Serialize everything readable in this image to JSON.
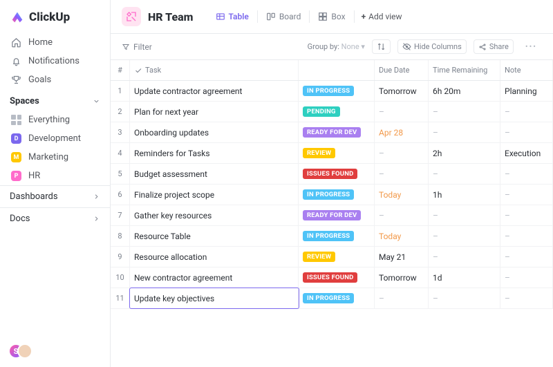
{
  "brand": "ClickUp",
  "nav": {
    "home": "Home",
    "notifications": "Notifications",
    "goals": "Goals"
  },
  "spaces": {
    "header": "Spaces",
    "everything": "Everything",
    "items": [
      {
        "label": "Development",
        "letter": "D",
        "color": "#7b68ee"
      },
      {
        "label": "Marketing",
        "letter": "M",
        "color": "#ffc800"
      },
      {
        "label": "HR",
        "letter": "P",
        "color": "#ff6bcb"
      }
    ]
  },
  "dashboards": "Dashboards",
  "docs": "Docs",
  "header": {
    "title": "HR Team",
    "tabs": {
      "table": "Table",
      "board": "Board",
      "box": "Box"
    },
    "add_view": "Add view"
  },
  "toolbar": {
    "filter": "Filter",
    "group_by": "Group by:",
    "group_by_val": "None",
    "hide_cols": "Hide Columns",
    "share": "Share"
  },
  "columns": {
    "num": "#",
    "task": "Task",
    "due": "Due Date",
    "remaining": "Time Remaining",
    "note": "Note"
  },
  "status_colors": {
    "IN PROGRESS": "#4fc3f7",
    "PENDING": "#2ecfc0",
    "READY FOR DEV": "#a97ff0",
    "REVIEW": "#ffc800",
    "ISSUES FOUND": "#e03e3e"
  },
  "rows": [
    {
      "n": "1",
      "name": "Update contractor agreement",
      "status": "IN PROGRESS",
      "due": "Tomorrow",
      "due_cls": "",
      "rem": "6h 20m",
      "note": "Planning"
    },
    {
      "n": "2",
      "name": "Plan for next year",
      "status": "PENDING",
      "due": "–",
      "due_cls": "dash-txt",
      "rem": "–",
      "note": "–"
    },
    {
      "n": "3",
      "name": "Onboarding updates",
      "status": "READY FOR DEV",
      "due": "Apr 28",
      "due_cls": "due-soon",
      "rem": "–",
      "note": "–"
    },
    {
      "n": "4",
      "name": "Reminders for Tasks",
      "status": "REVIEW",
      "due": "–",
      "due_cls": "dash-txt",
      "rem": "2h",
      "note": "Execution"
    },
    {
      "n": "5",
      "name": "Budget assessment",
      "status": "ISSUES FOUND",
      "due": "–",
      "due_cls": "dash-txt",
      "rem": "–",
      "note": "–"
    },
    {
      "n": "6",
      "name": "Finalize project scope",
      "status": "IN PROGRESS",
      "due": "Today",
      "due_cls": "due-today",
      "rem": "1h",
      "note": "–"
    },
    {
      "n": "7",
      "name": "Gather key resources",
      "status": "READY FOR DEV",
      "due": "–",
      "due_cls": "dash-txt",
      "rem": "–",
      "note": "–"
    },
    {
      "n": "8",
      "name": "Resource Table",
      "status": "IN PROGRESS",
      "due": "Today",
      "due_cls": "due-today",
      "rem": "–",
      "note": "–"
    },
    {
      "n": "9",
      "name": "Resource allocation",
      "status": "REVIEW",
      "due": "May 21",
      "due_cls": "",
      "rem": "–",
      "note": "–"
    },
    {
      "n": "10",
      "name": "New contractor agreement",
      "status": "ISSUES FOUND",
      "due": "Tomorrow",
      "due_cls": "",
      "rem": "1d",
      "note": "–"
    },
    {
      "n": "11",
      "name": "Update key objectives",
      "status": "IN PROGRESS",
      "due": "–",
      "due_cls": "dash-txt",
      "rem": "–",
      "note": "–",
      "editing": true
    }
  ]
}
